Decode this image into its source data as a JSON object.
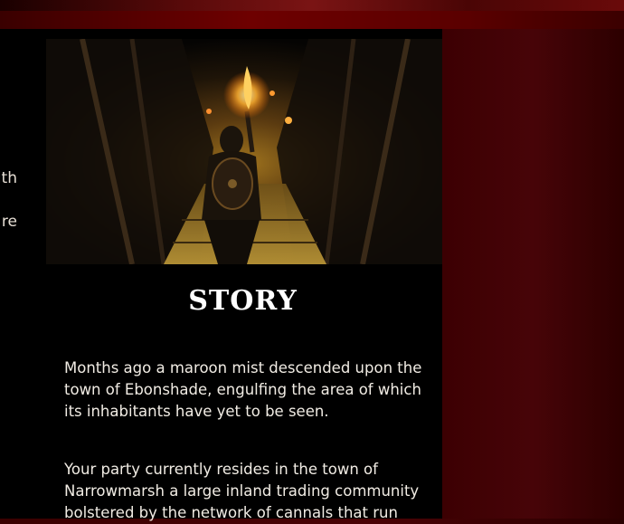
{
  "left_column": {
    "fragments": [
      "ith",
      "re"
    ]
  },
  "story": {
    "title": "STORY",
    "paragraphs": [
      "Months ago a maroon mist descended upon the town of Ebonshade, engulfing the area of which its inhabitants have yet to be seen.",
      "Your party currently resides in the town of Narrowmarsh a large inland trading community bolstered by the network of cannals that run"
    ]
  },
  "colors": {
    "background": "#3a0000",
    "panel": "#000000",
    "text": "#f1ece4",
    "title": "#ffffff"
  }
}
